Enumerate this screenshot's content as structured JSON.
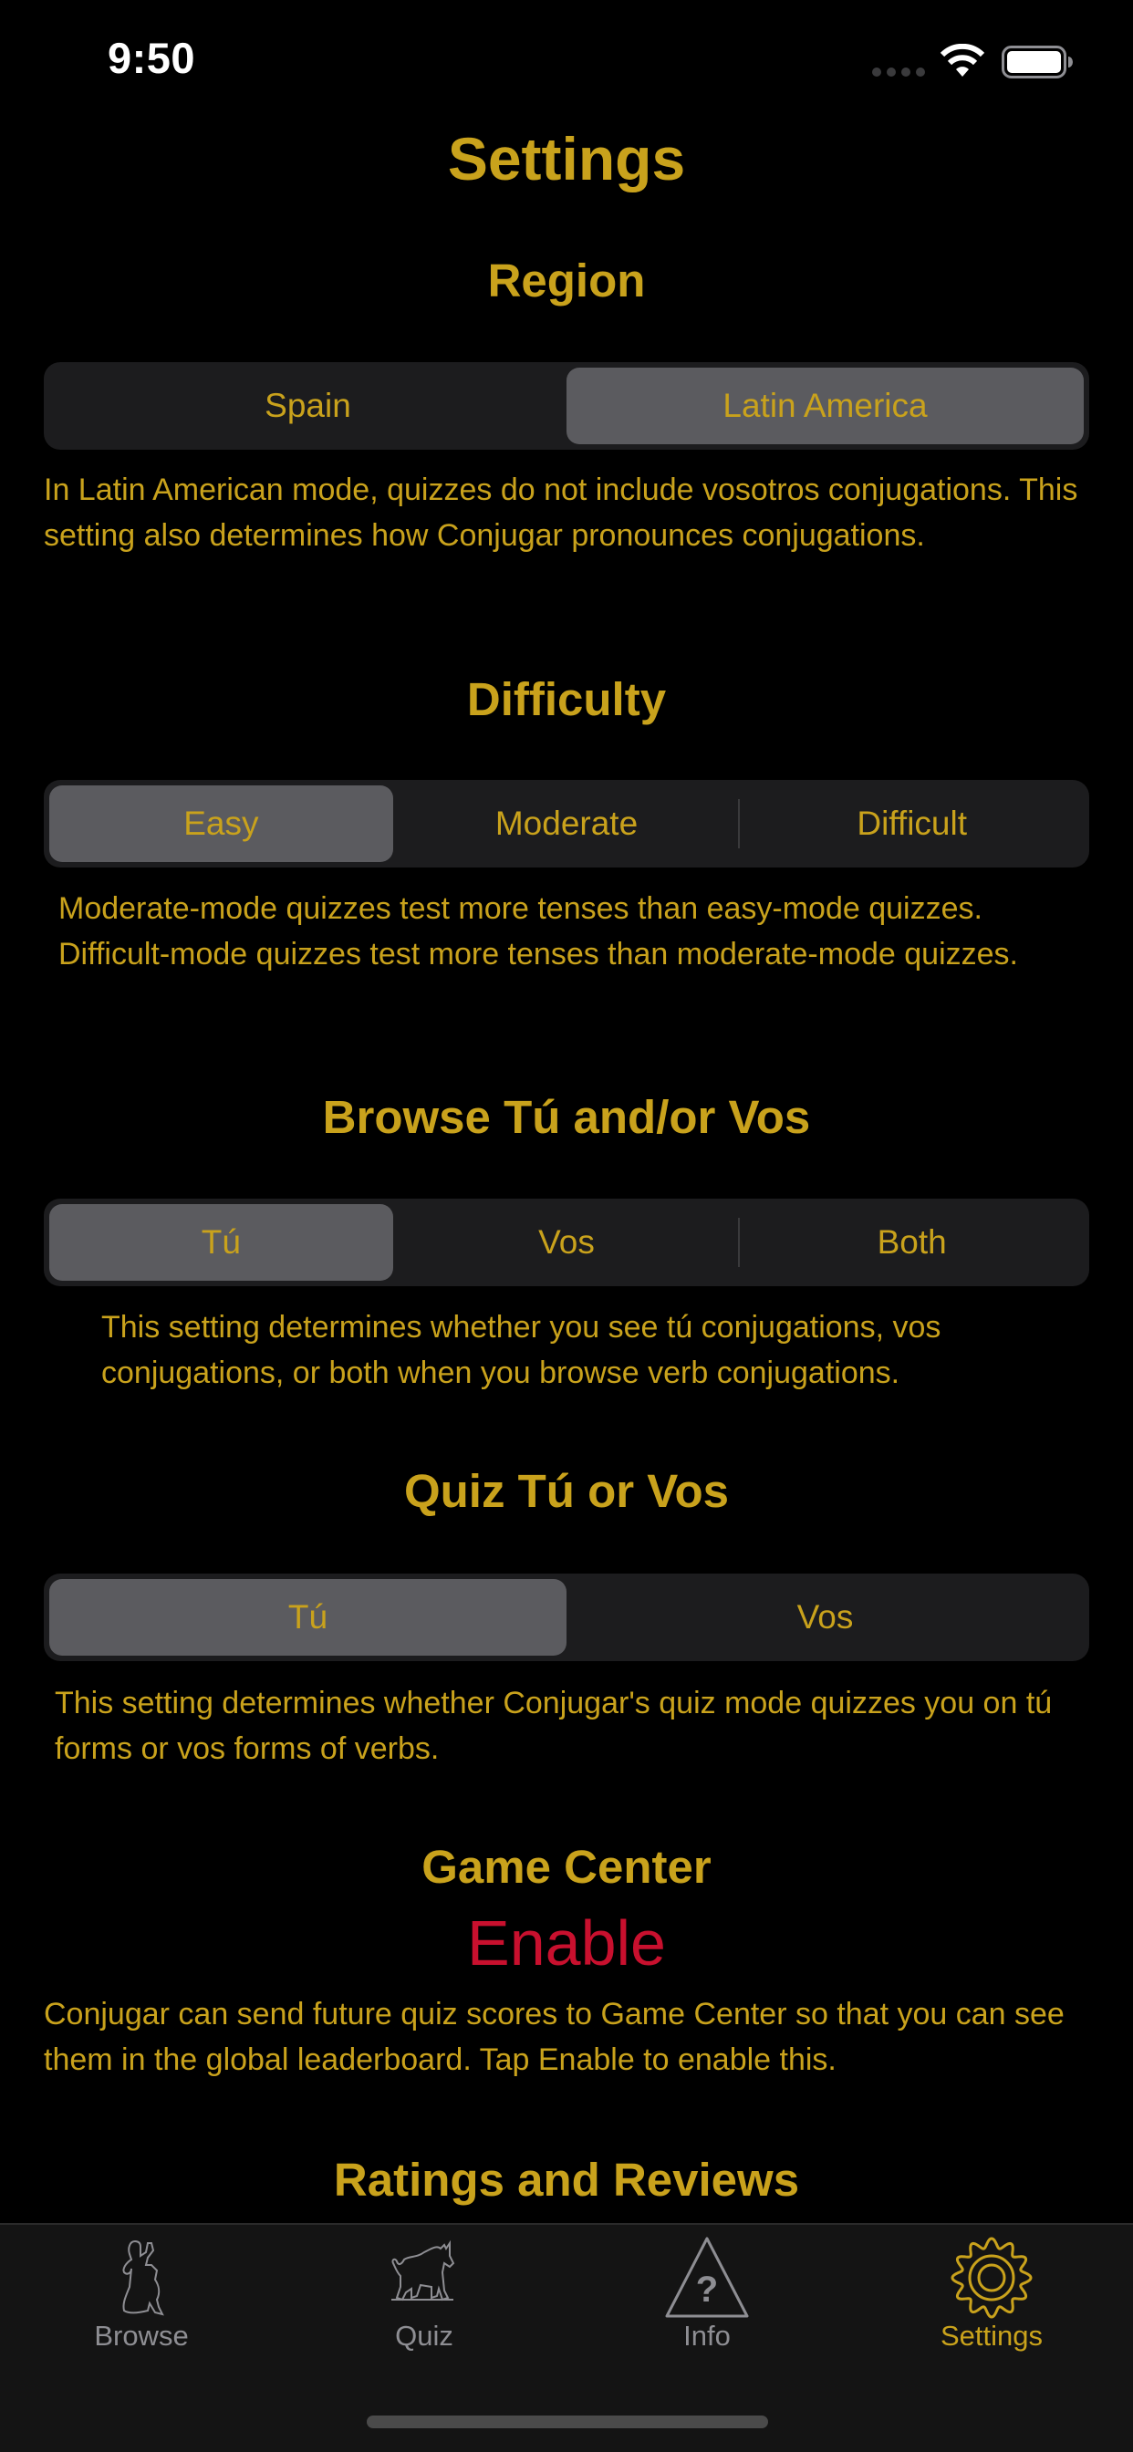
{
  "status_bar": {
    "time": "9:50"
  },
  "page": {
    "title": "Settings"
  },
  "colors": {
    "accent": "#c9a21c",
    "enable": "#c8102e",
    "segment_bg": "#1c1c1e",
    "segment_selected": "#5b5b5f",
    "tabbar_bg": "#141414",
    "tab_inactive": "#8e8e93"
  },
  "region": {
    "title": "Region",
    "options": [
      "Spain",
      "Latin America"
    ],
    "selected": "Latin America",
    "description": "In Latin American mode, quizzes do not include vosotros conjugations. This setting also determines how Conjugar pronounces conjugations."
  },
  "difficulty": {
    "title": "Difficulty",
    "options": [
      "Easy",
      "Moderate",
      "Difficult"
    ],
    "selected": "Easy",
    "description": "Moderate-mode quizzes test more tenses than easy-mode quizzes. Difficult-mode quizzes test more tenses than moderate-mode quizzes."
  },
  "browse_tu_vos": {
    "title": "Browse Tú and/or Vos",
    "options": [
      "Tú",
      "Vos",
      "Both"
    ],
    "selected": "Tú",
    "description": "This setting determines whether you see tú conjugations, vos conjugations, or both when you browse verb conjugations."
  },
  "quiz_tu_vos": {
    "title": "Quiz Tú or Vos",
    "options": [
      "Tú",
      "Vos"
    ],
    "selected": "Tú",
    "description": "This setting determines whether Conjugar's quiz mode quizzes you on tú forms or vos forms of verbs."
  },
  "game_center": {
    "title": "Game Center",
    "button_label": "Enable",
    "description": "Conjugar can send future quiz scores to Game Center so that you can see them in the global leaderboard. Tap Enable to enable this."
  },
  "ratings": {
    "title": "Ratings and Reviews"
  },
  "tab_bar": {
    "items": [
      {
        "label": "Browse",
        "icon": "dancer-icon",
        "active": false
      },
      {
        "label": "Quiz",
        "icon": "bull-icon",
        "active": false
      },
      {
        "label": "Info",
        "icon": "question-triangle-icon",
        "active": false
      },
      {
        "label": "Settings",
        "icon": "gear-icon",
        "active": true
      }
    ]
  }
}
